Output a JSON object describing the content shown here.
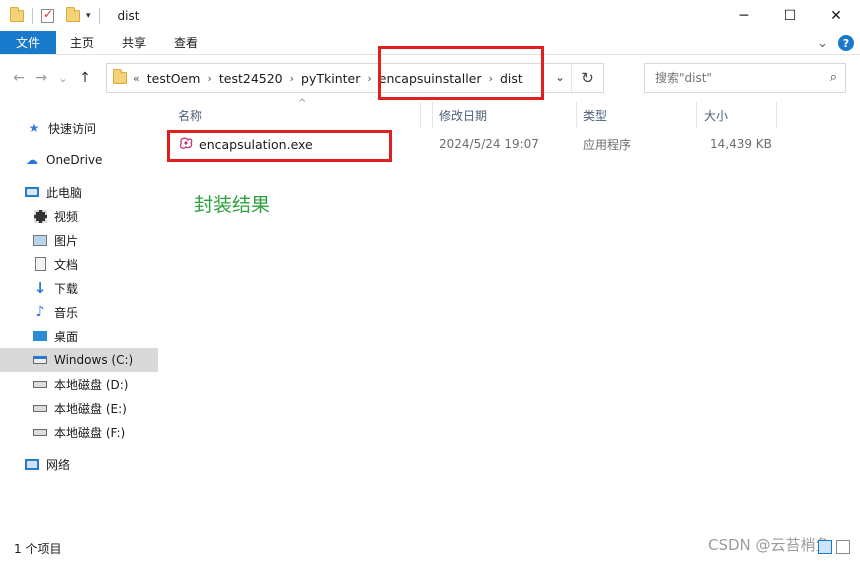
{
  "window": {
    "title": "dist",
    "minimize_icon": "─",
    "maximize_icon": "☐",
    "close_icon": "✕"
  },
  "ribbon": {
    "tabs": [
      "文件",
      "主页",
      "共享",
      "查看"
    ],
    "expand_icon": "⌄",
    "help_label": "?"
  },
  "address": {
    "overflow": "«",
    "crumbs": [
      "testOem",
      "test24520",
      "pyTkinter",
      "encapsuinstaller",
      "dist"
    ],
    "separator": "›",
    "dropdown_icon": "⌄",
    "refresh_icon": "↻"
  },
  "nav_buttons": {
    "back": "←",
    "forward": "→",
    "recent": "⌄",
    "up": "↑"
  },
  "search": {
    "placeholder": "搜索\"dist\"",
    "icon": "⌕"
  },
  "sidebar": {
    "items": [
      {
        "label": "快速访问",
        "icon": "star-icon"
      },
      {
        "label": "OneDrive",
        "icon": "cloud-icon"
      },
      {
        "label": "此电脑",
        "icon": "computer-icon"
      },
      {
        "label": "视频",
        "icon": "video-icon"
      },
      {
        "label": "图片",
        "icon": "picture-icon"
      },
      {
        "label": "文档",
        "icon": "document-icon"
      },
      {
        "label": "下载",
        "icon": "download-icon"
      },
      {
        "label": "音乐",
        "icon": "music-icon"
      },
      {
        "label": "桌面",
        "icon": "desktop-icon"
      },
      {
        "label": "Windows (C:)",
        "icon": "drive-icon"
      },
      {
        "label": "本地磁盘 (D:)",
        "icon": "drive-icon"
      },
      {
        "label": "本地磁盘 (E:)",
        "icon": "drive-icon"
      },
      {
        "label": "本地磁盘 (F:)",
        "icon": "drive-icon"
      },
      {
        "label": "网络",
        "icon": "network-icon"
      }
    ]
  },
  "columns": {
    "name": "名称",
    "modified": "修改日期",
    "type": "类型",
    "size": "大小",
    "sort_glyph": "^"
  },
  "files": [
    {
      "name": "encapsulation.exe",
      "modified": "2024/5/24 19:07",
      "type": "应用程序",
      "size": "14,439 KB",
      "icon": "exe-icon"
    }
  ],
  "annotation": "封装结果",
  "status": {
    "count": "1 个项目"
  },
  "watermark": "CSDN @云苔梢鱼",
  "colors": {
    "accent": "#1979ca",
    "highlight_box": "#e02020",
    "annotation": "#2ca13e",
    "selected_nav": "#d9d9d9"
  }
}
